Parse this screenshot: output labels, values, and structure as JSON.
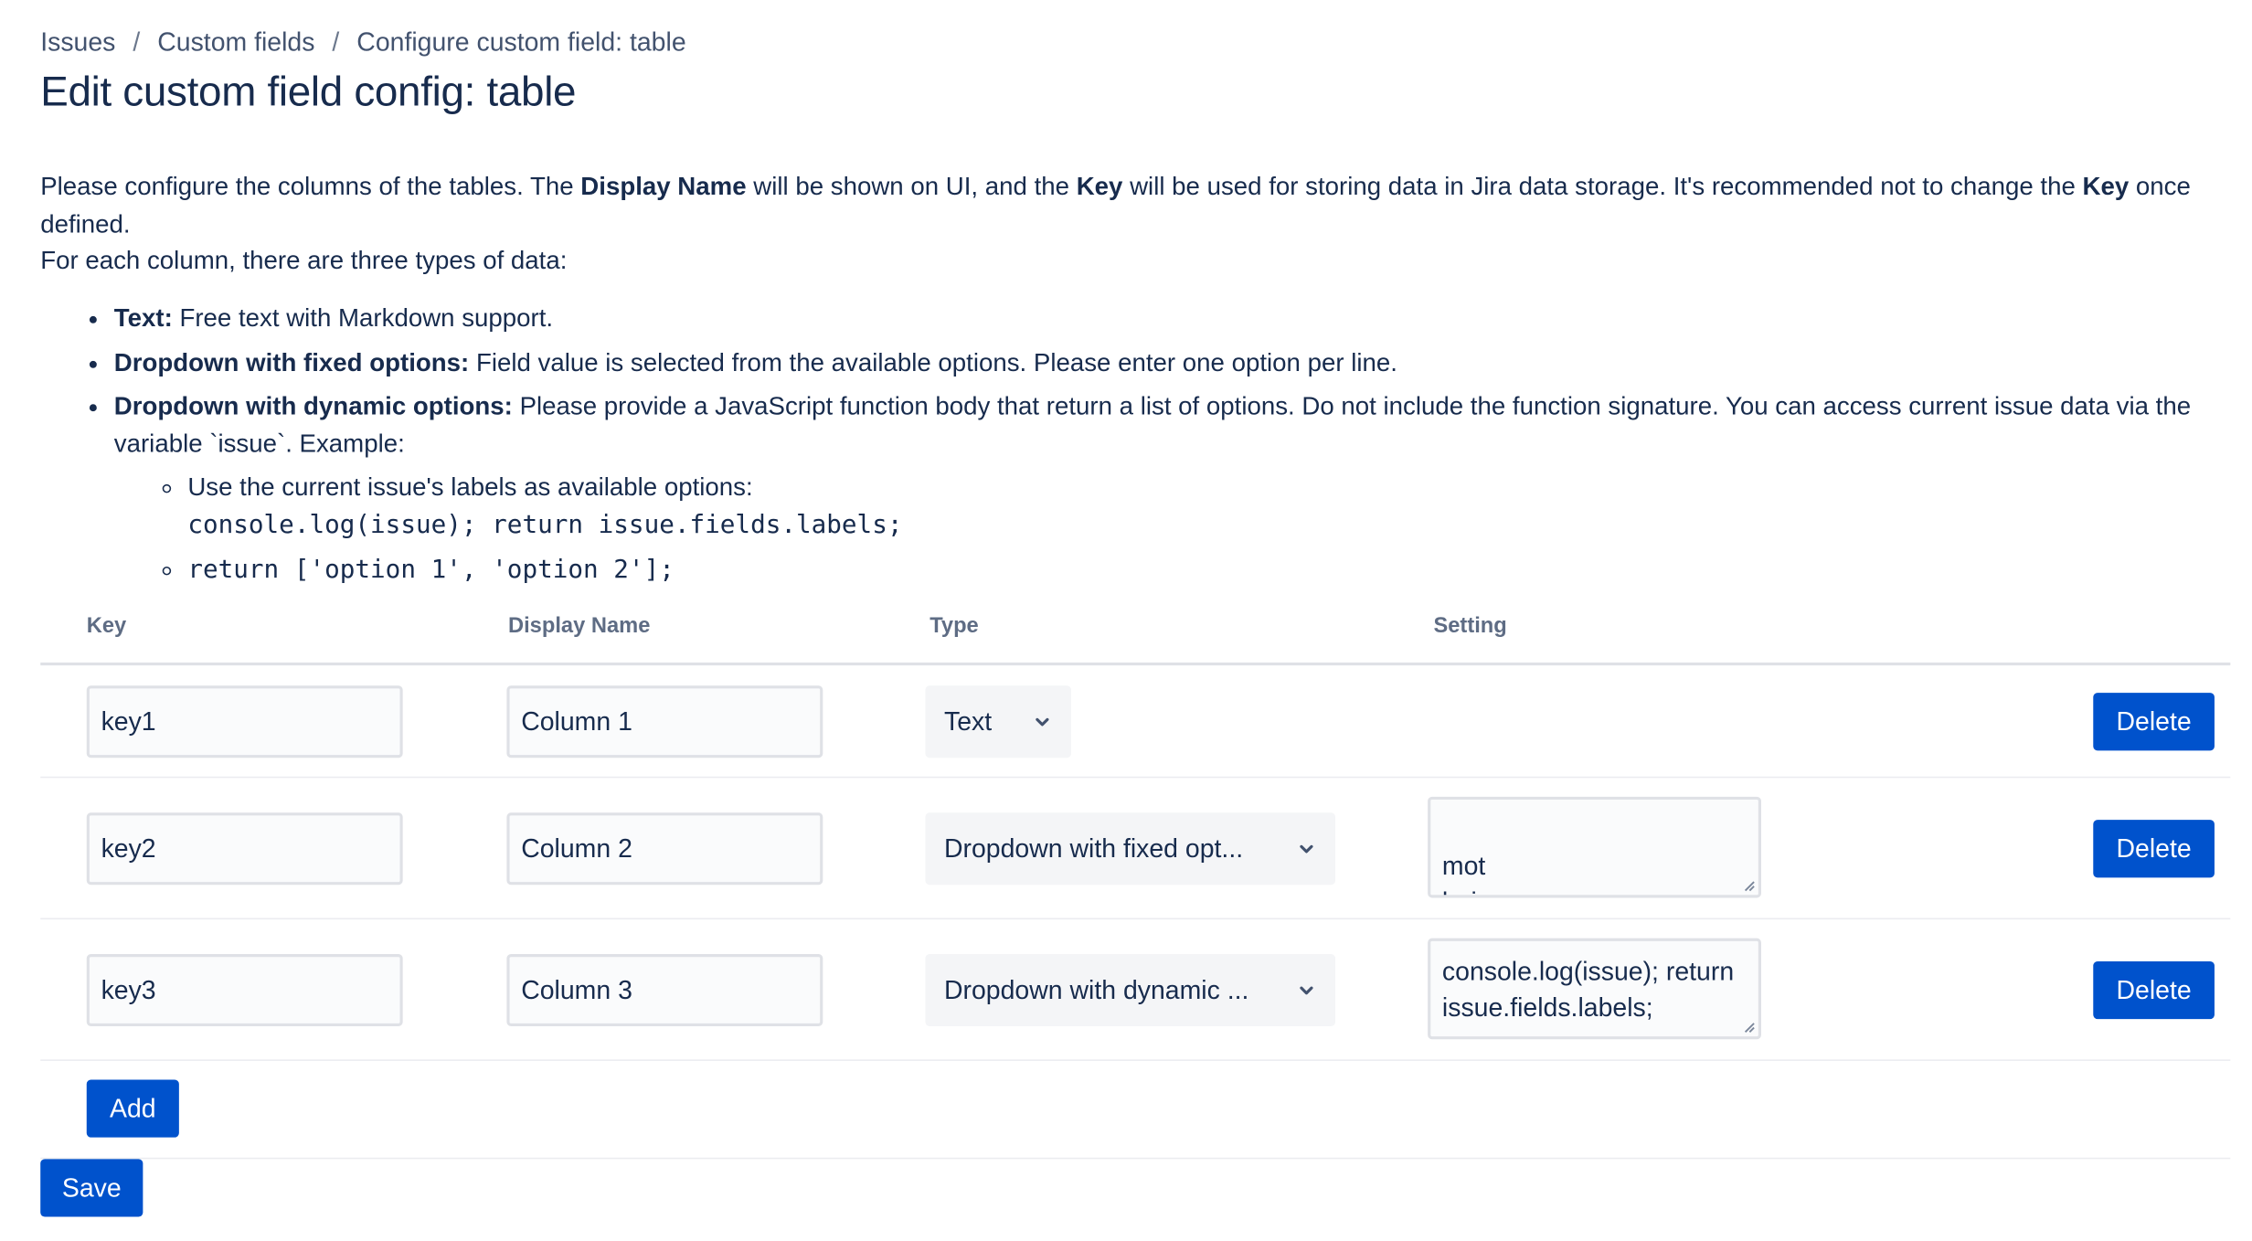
{
  "breadcrumb": [
    {
      "label": "Issues"
    },
    {
      "label": "Custom fields"
    },
    {
      "label": "Configure custom field: table"
    }
  ],
  "breadcrumb_separator": "/",
  "page_title": "Edit custom field config: table",
  "intro": {
    "p1_a": "Please configure the columns of the tables. The ",
    "p1_b": "Display Name",
    "p1_c": " will be shown on UI, and the ",
    "p1_d": "Key",
    "p1_e": " will be used for storing data in Jira data storage. It's recommended not to change the ",
    "p1_f": "Key",
    "p1_g": " once defined.",
    "p2": "For each column, there are three types of data:"
  },
  "types": [
    {
      "term": "Text:",
      "desc": " Free text with Markdown support."
    },
    {
      "term": "Dropdown with fixed options:",
      "desc": " Field value is selected from the available options. Please enter one option per line."
    },
    {
      "term": "Dropdown with dynamic options:",
      "desc": " Please provide a JavaScript function body that return a list of options. Do not include the function signature. You can access current issue data via the variable `issue`. Example:"
    }
  ],
  "examples": [
    {
      "text": "Use the current issue's labels as available options:",
      "code": "console.log(issue); return issue.fields.labels;"
    },
    {
      "code": "return ['option 1', 'option 2'];"
    }
  ],
  "table": {
    "headers": {
      "key": "Key",
      "display_name": "Display Name",
      "type": "Type",
      "setting": "Setting"
    },
    "rows": [
      {
        "key": "key1",
        "display_name": "Column 1",
        "type": "Text",
        "setting": null,
        "delete_label": "Delete"
      },
      {
        "key": "key2",
        "display_name": "Column 2",
        "type": "Dropdown with fixed opt...",
        "setting": "mot\nhai",
        "delete_label": "Delete"
      },
      {
        "key": "key3",
        "display_name": "Column 3",
        "type": "Dropdown with dynamic ...",
        "setting": "console.log(issue); return issue.fields.labels;",
        "delete_label": "Delete"
      }
    ]
  },
  "buttons": {
    "add": "Add",
    "save": "Save"
  },
  "colors": {
    "primary": "#0052CC",
    "text": "#172B4D",
    "subtle_text": "#5E6C84",
    "border": "#DFE1E6",
    "field_bg": "#FAFBFC",
    "select_bg": "#F4F5F7"
  },
  "icons": {
    "select_arrow": "chevron-down-icon",
    "textarea_resize": "resize-grip-icon"
  }
}
